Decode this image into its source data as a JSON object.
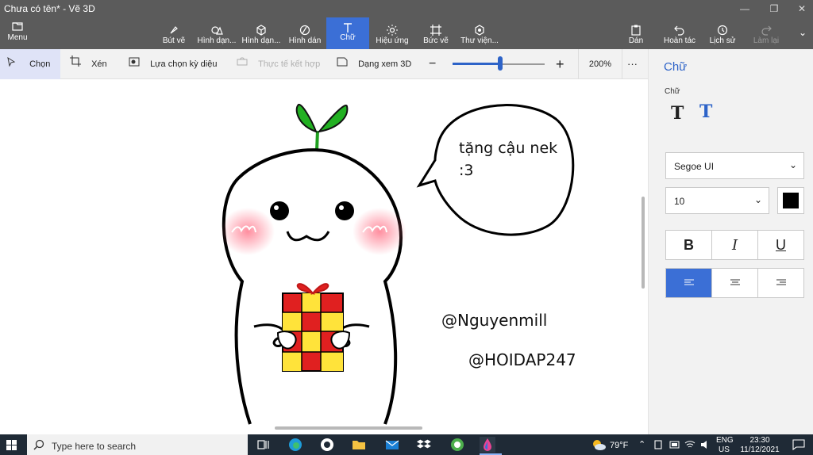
{
  "window": {
    "title": "Chưa có tên* - Vẽ 3D"
  },
  "ribbon": {
    "menu": "Menu",
    "brushes": "Bút vẽ",
    "shapes2d": "Hình dạn...",
    "shapes3d": "Hình dạn...",
    "stickers": "Hình dán",
    "text": "Chữ",
    "effects": "Hiệu ứng",
    "canvas": "Bức vẽ",
    "library": "Thư viện...",
    "paste": "Dán",
    "undo": "Hoàn tác",
    "history": "Lịch sử",
    "redo": "Làm lại"
  },
  "toolbar": {
    "select": "Chọn",
    "crop": "Xén",
    "magic_select": "Lựa chọn kỳ diệu",
    "mixed_reality": "Thực tế kết hợp",
    "view3d": "Dạng xem 3D",
    "zoom_level": "200%",
    "zoom_fraction": 0.52,
    "more": "···"
  },
  "canvas": {
    "speech_text_1": "tặng cậu nek",
    "speech_text_2": ":3",
    "watermark_1": "@Nguyenmill",
    "watermark_2": "@HOIDAP247"
  },
  "panel": {
    "heading": "Chữ",
    "label": "Chữ",
    "font_name": "Segoe UI",
    "font_size": "10",
    "text_color": "#000000",
    "bold": "B",
    "italic": "I",
    "underline": "U",
    "accent": "#3b6fd6"
  },
  "taskbar": {
    "search_placeholder": "Type here to search",
    "weather": "79°F",
    "lang_1": "ENG",
    "lang_2": "US",
    "time": "23:30",
    "date": "11/12/2021"
  }
}
